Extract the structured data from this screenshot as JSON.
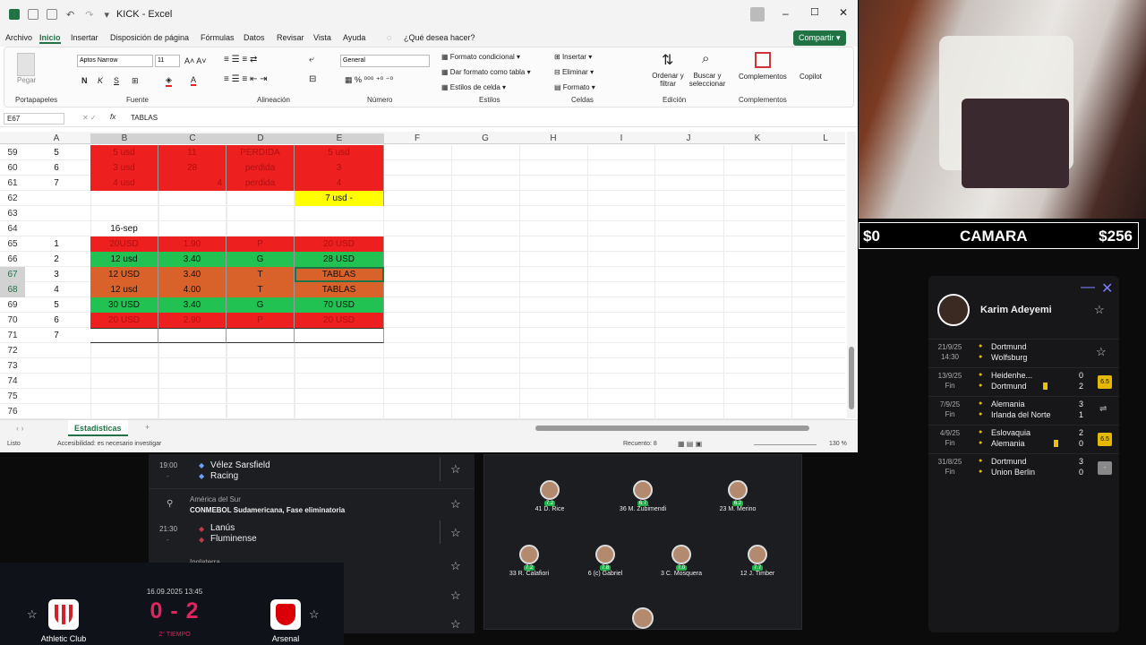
{
  "excel": {
    "title": "KICK  -  Excel",
    "menu": [
      "Archivo",
      "Inicio",
      "Insertar",
      "Disposición de página",
      "Fórmulas",
      "Datos",
      "Revisar",
      "Vista",
      "Ayuda"
    ],
    "tell_me": "¿Qué desea hacer?",
    "share": "Compartir",
    "ribbon": {
      "paste": "Pegar",
      "clipboard": "Portapapeles",
      "font_name": "Aptos Narrow",
      "font_size": "11",
      "font": "Fuente",
      "alignment": "Alineación",
      "number_format": "General",
      "number": "Número",
      "cond_format": "Formato condicional",
      "table_format": "Dar formato como tabla",
      "cell_styles": "Estilos de celda",
      "styles": "Estilos",
      "insert": "Insertar",
      "delete": "Eliminar",
      "format": "Formato",
      "cells": "Celdas",
      "sort": "Ordenar y filtrar",
      "find": "Buscar y seleccionar",
      "editing": "Edición",
      "addins": "Complementos",
      "addins_group": "Complementos",
      "copilot": "Copilot"
    },
    "name_box": "E67",
    "fx": "fx",
    "formula": "TABLAS",
    "columns": [
      "A",
      "B",
      "C",
      "D",
      "E",
      "F",
      "G",
      "H",
      "I",
      "J",
      "K",
      "L"
    ],
    "rows": [
      {
        "n": "59",
        "a": "5",
        "b": "5 usd",
        "c": "11",
        "d": "PERDIDA",
        "e": "5 usd",
        "style": "r"
      },
      {
        "n": "60",
        "a": "6",
        "b": "3 usd",
        "c": "28",
        "d": "perdida",
        "e": "3",
        "style": "r"
      },
      {
        "n": "61",
        "a": "7",
        "b": "4 usd",
        "c": "4",
        "d": "perdida",
        "e": "4",
        "style": "r"
      },
      {
        "n": "62",
        "a": "",
        "b": "",
        "c": "",
        "d": "",
        "e": "7 usd -",
        "style": "y"
      },
      {
        "n": "63",
        "a": "",
        "b": "",
        "c": "",
        "d": "",
        "e": "",
        "style": ""
      },
      {
        "n": "64",
        "a": "",
        "b": "16-sep",
        "c": "",
        "d": "",
        "e": "",
        "style": ""
      },
      {
        "n": "65",
        "a": "1",
        "b": "20USD",
        "c": "1.90",
        "d": "P",
        "e": "20 USD",
        "style": "r"
      },
      {
        "n": "66",
        "a": "2",
        "b": "12 usd",
        "c": "3.40",
        "d": "G",
        "e": "28 USD",
        "style": "g"
      },
      {
        "n": "67",
        "a": "3",
        "b": "12 USD",
        "c": "3.40",
        "d": "T",
        "e": "TABLAS",
        "style": "o"
      },
      {
        "n": "68",
        "a": "4",
        "b": "12 usd",
        "c": "4.00",
        "d": "T",
        "e": "TABLAS",
        "style": "o"
      },
      {
        "n": "69",
        "a": "5",
        "b": "30 USD",
        "c": "3.40",
        "d": "G",
        "e": "70 USD",
        "style": "g"
      },
      {
        "n": "70",
        "a": "6",
        "b": "20 USD",
        "c": "2.90",
        "d": "P",
        "e": "20 USD",
        "style": "r"
      },
      {
        "n": "71",
        "a": "7",
        "b": "",
        "c": "",
        "d": "",
        "e": "",
        "style": "w"
      },
      {
        "n": "72",
        "a": "",
        "b": "",
        "c": "",
        "d": "",
        "e": "",
        "style": ""
      },
      {
        "n": "73",
        "a": "",
        "b": "",
        "c": "",
        "d": "",
        "e": "",
        "style": ""
      },
      {
        "n": "74",
        "a": "",
        "b": "",
        "c": "",
        "d": "",
        "e": "",
        "style": ""
      },
      {
        "n": "75",
        "a": "",
        "b": "",
        "c": "",
        "d": "",
        "e": "",
        "style": ""
      },
      {
        "n": "76",
        "a": "",
        "b": "",
        "c": "",
        "d": "",
        "e": "",
        "style": ""
      }
    ],
    "sheet_tab": "Estadisticas",
    "status_ready": "Listo",
    "status_access": "Accesibilidad: es necesario investigar",
    "status_count": "Recuento: 8",
    "zoom": "130 %"
  },
  "camera": {
    "left": "$0",
    "title": "CAMARA",
    "right": "$256"
  },
  "player": {
    "name": "Karim Adeyemi",
    "matches": [
      {
        "date": "21/9/25",
        "time": "14:30",
        "home": "Dortmund",
        "away": "Wolfsburg",
        "hs": "",
        "as": "",
        "rating": ""
      },
      {
        "date": "13/9/25",
        "time": "Fin",
        "home": "Heidenhe...",
        "away": "Dortmund",
        "hs": "0",
        "as": "2",
        "rating": "6.5"
      },
      {
        "date": "7/9/25",
        "time": "Fin",
        "home": "Alemania",
        "away": "Irlanda del Norte",
        "hs": "3",
        "as": "1",
        "rating": ""
      },
      {
        "date": "4/9/25",
        "time": "Fin",
        "home": "Eslovaquia",
        "away": "Alemania",
        "hs": "2",
        "as": "0",
        "rating": "6.5"
      },
      {
        "date": "31/8/25",
        "time": "Fin",
        "home": "Dortmund",
        "away": "Union Berlin",
        "hs": "3",
        "as": "0",
        "rating": "-"
      }
    ]
  },
  "matches": {
    "m1": {
      "time": "19:00",
      "dash": "-",
      "home": "Vélez Sarsfield",
      "away": "Racing"
    },
    "league_region": "América del Sur",
    "league_name": "CONMEBOL Sudamericana, Fase eliminatoria",
    "m2": {
      "time": "21:30",
      "dash": "-",
      "home": "Lanús",
      "away": "Fluminense"
    },
    "m3": {
      "partial": "Inglaterra"
    }
  },
  "lineup": {
    "players": [
      {
        "num": "41",
        "name": "D. Rice",
        "rating": "7.2"
      },
      {
        "num": "36",
        "name": "M. Zubimendi",
        "rating": "6.7"
      },
      {
        "num": "23",
        "name": "M. Merino",
        "rating": "6.2"
      },
      {
        "num": "33",
        "name": "R. Calafiori",
        "rating": "7.2"
      },
      {
        "num": "6",
        "name": "(c) Gabriel",
        "rating": "7.8"
      },
      {
        "num": "3",
        "name": "C. Mosquera",
        "rating": "7.0"
      },
      {
        "num": "12",
        "name": "J. Timber",
        "rating": "7.7"
      }
    ]
  },
  "score": {
    "datetime": "16.09.2025 13:45",
    "score": "0 - 2",
    "period": "2° TIEMPO",
    "home": "Athletic Club",
    "away": "Arsenal"
  },
  "colors": {
    "excel_green": "#217346",
    "red": "#ee1f1f",
    "green": "#21c251",
    "orange": "#d9622a",
    "yellow": "#ffff00",
    "score_red": "#e0245e"
  }
}
